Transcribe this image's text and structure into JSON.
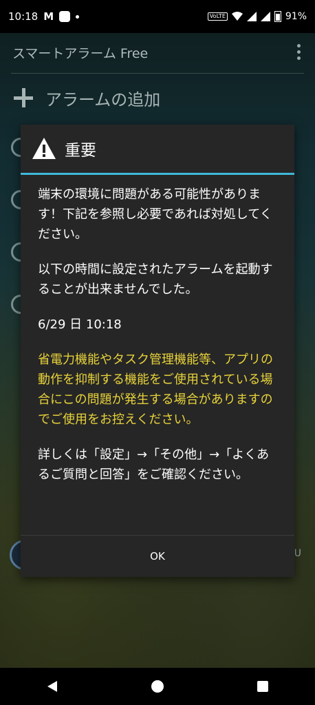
{
  "status_bar": {
    "time": "10:18",
    "mail_letter": "M",
    "volte": "VoLTE",
    "battery": "91%"
  },
  "background_app": {
    "title": "スマートアラーム Free",
    "add_alarm_label": "アラームの追加",
    "bottom_right_text": "U"
  },
  "dialog": {
    "title": "重要",
    "paragraphs": [
      "端末の環境に問題がある可能性があります！下記を参照し必要であれば対処してください。",
      "以下の時間に設定されたアラームを起動することが出来ませんでした。",
      "6/29 日 10:18",
      "省電力機能やタスク管理機能等、アプリの動作を抑制する機能をご使用されている場合にこの問題が発生する場合がありますのでご使用をお控えください。",
      "詳しくは「設定」→「その他」→「よくあるご質問と回答」をご確認ください。"
    ],
    "ok_label": "OK"
  },
  "colors": {
    "accent_rule": "#3fb9d9",
    "warning_text": "#e8d33a",
    "dialog_bg": "#262626"
  }
}
